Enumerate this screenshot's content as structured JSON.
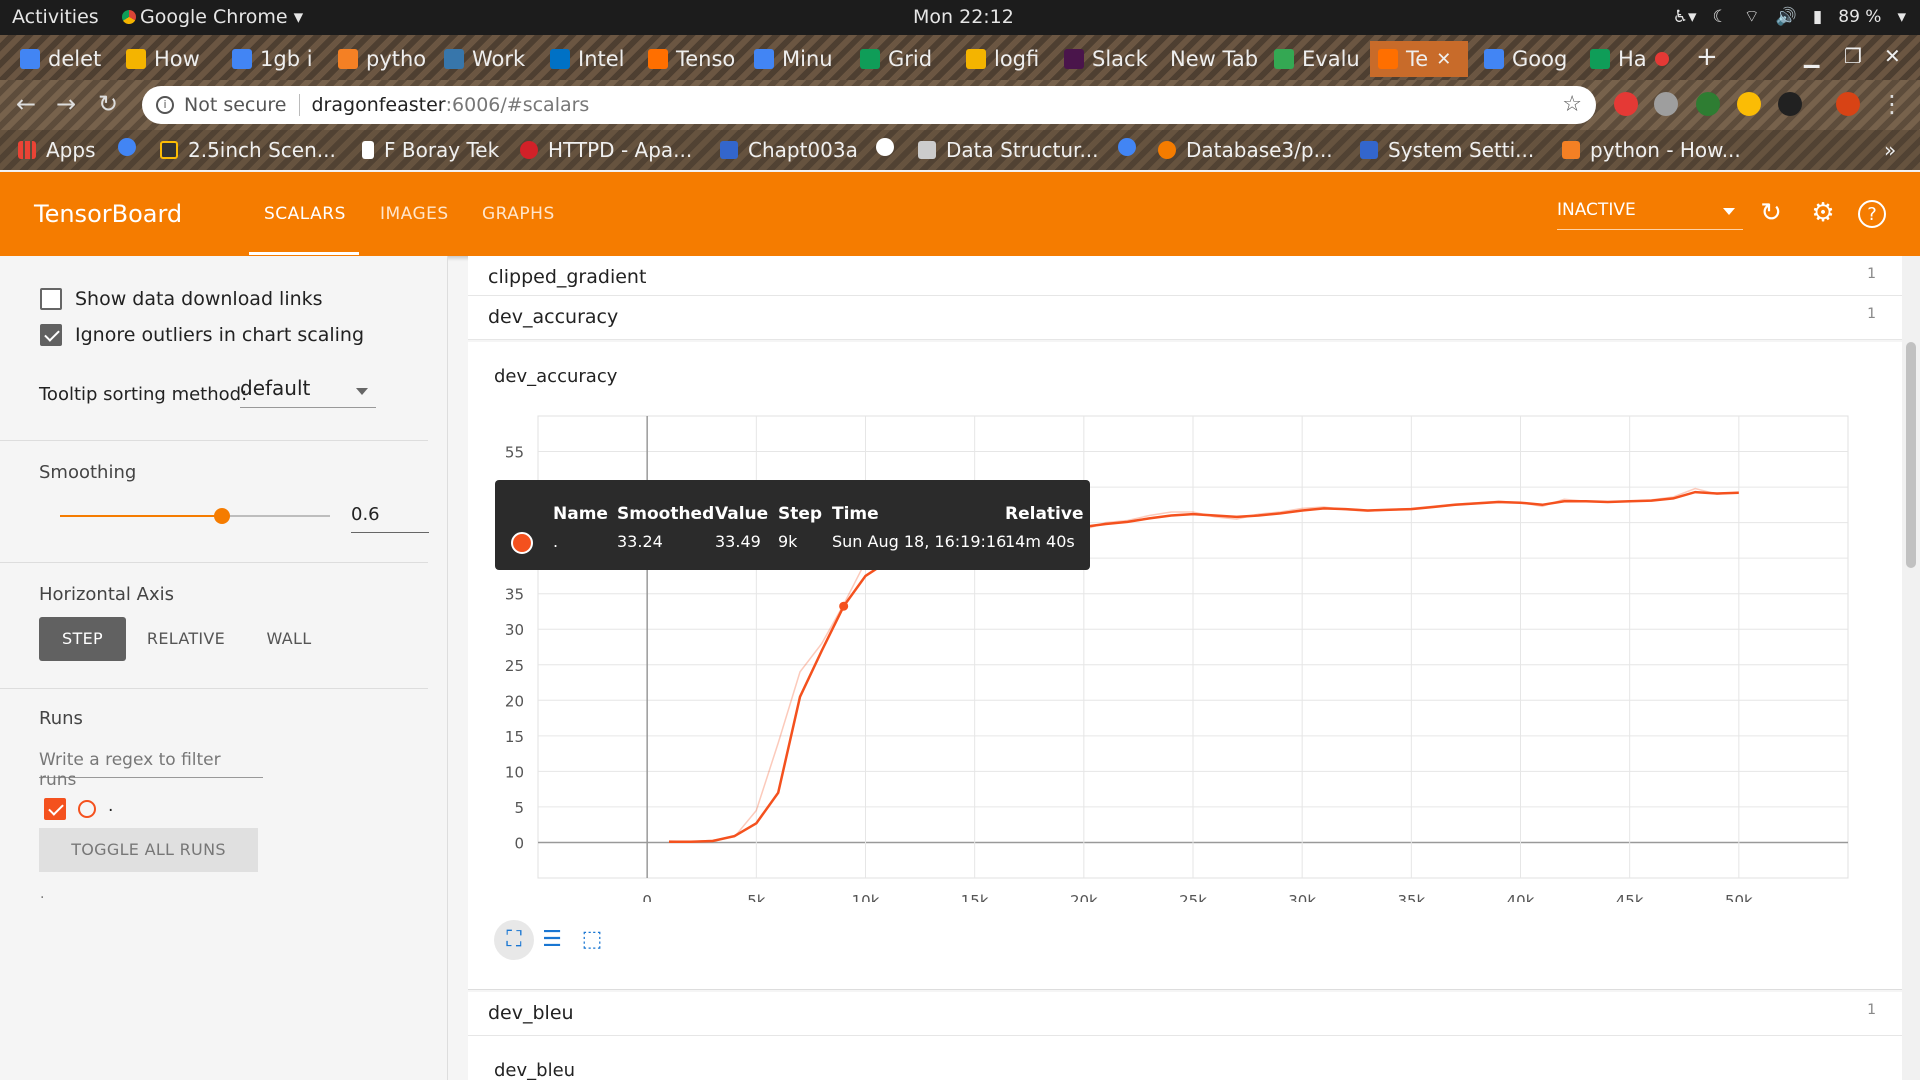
{
  "gnome": {
    "activities": "Activities",
    "app_name": "Google Chrome ▾",
    "clock": "Mon 22:12",
    "battery": "89 %"
  },
  "tabs": [
    {
      "title": "delet",
      "color": "#4285f4"
    },
    {
      "title": "How",
      "color": "#f4b400"
    },
    {
      "title": "1gb i",
      "color": "#4285f4"
    },
    {
      "title": "pytho",
      "color": "#f48024"
    },
    {
      "title": "Work",
      "color": "#3776ab"
    },
    {
      "title": "Intel",
      "color": "#0071c5"
    },
    {
      "title": "Tenso",
      "color": "#ff6f00"
    },
    {
      "title": "Minu",
      "color": "#4285f4"
    },
    {
      "title": "Grid",
      "color": "#0f9d58"
    },
    {
      "title": "logfi",
      "color": "#f4b400"
    },
    {
      "title": "Slack",
      "color": "#4a154b"
    },
    {
      "title": "New Tab",
      "color": ""
    },
    {
      "title": "Evalu",
      "color": "#34a853"
    },
    {
      "title": "Te",
      "color": "#ff6f00"
    },
    {
      "title": "Goog",
      "color": "#4285f4"
    },
    {
      "title": "Ha",
      "color": "#0f9d58"
    }
  ],
  "address": {
    "security": "Not secure",
    "host": "dragonfeaster",
    "path": ":6006/#scalars"
  },
  "bookmarks": [
    {
      "label": "Apps",
      "color": "#ea4335"
    },
    {
      "label": "2.5inch Scen...",
      "color": "#333333"
    },
    {
      "label": "F Boray Tek",
      "color": "#ffffff"
    },
    {
      "label": "HTTPD - Apa...",
      "color": "#d22128"
    },
    {
      "label": "Chapt003a",
      "color": "#3366cc"
    },
    {
      "label": "Data Structur...",
      "color": "#cccccc"
    },
    {
      "label": "Database3/p...",
      "color": "#f57c00"
    },
    {
      "label": "System Setti...",
      "color": "#3366cc"
    },
    {
      "label": "python - How...",
      "color": "#f48024"
    }
  ],
  "tensorboard": {
    "title": "TensorBoard",
    "tabs": [
      "SCALARS",
      "IMAGES",
      "GRAPHS"
    ],
    "run_state": "INACTIVE"
  },
  "sidebar": {
    "show_download": "Show data download links",
    "ignore_outliers": "Ignore outliers in chart scaling",
    "tooltip_sort_label": "Tooltip sorting method:",
    "tooltip_sort_value": "default",
    "smoothing_label": "Smoothing",
    "smoothing_value": "0.6",
    "smoothing_fraction": 0.6,
    "horizontal_axis_label": "Horizontal Axis",
    "axis_options": [
      "STEP",
      "RELATIVE",
      "WALL"
    ],
    "runs_label": "Runs",
    "regex_placeholder": "Write a regex to filter runs",
    "run_name": ".",
    "toggle_all": "TOGGLE ALL RUNS",
    "footer_dot": "."
  },
  "main": {
    "groups": [
      {
        "label": "clipped_gradient",
        "count": "1"
      },
      {
        "label": "dev_accuracy",
        "count": "1"
      },
      {
        "label": "dev_bleu",
        "count": "1"
      }
    ],
    "chart_title": "dev_accuracy",
    "next_chart_title": "dev_bleu"
  },
  "tooltip": {
    "headers": [
      "Name",
      "Smoothed",
      "Value",
      "Step",
      "Time",
      "Relative"
    ],
    "row": [
      ".",
      "33.24",
      "33.49",
      "9k",
      "Sun Aug 18, 16:19:16",
      "14m 40s"
    ]
  },
  "chart_data": {
    "type": "line",
    "title": "dev_accuracy",
    "xlim": [
      -5000,
      55000
    ],
    "ylim": [
      -5,
      60
    ],
    "x_ticks": [
      "0",
      "5k",
      "10k",
      "15k",
      "20k",
      "25k",
      "30k",
      "35k",
      "40k",
      "45k",
      "50k"
    ],
    "y_ticks": [
      "0",
      "5",
      "10",
      "15",
      "20",
      "25",
      "30",
      "35",
      "40",
      "45",
      "50",
      "55"
    ],
    "color": "#f4511e",
    "series": [
      {
        "role": "raw",
        "x": [
          1000,
          2000,
          3000,
          4000,
          5000,
          6000,
          7000,
          8000,
          9000,
          10000,
          11000,
          12000,
          13000,
          14000,
          15000,
          16000,
          17000,
          18000,
          19000,
          20000,
          21000,
          22000,
          23000,
          24000,
          25000,
          26000,
          27000,
          28000,
          29000,
          30000,
          31000,
          32000,
          33000,
          34000,
          35000,
          36000,
          37000,
          38000,
          39000,
          40000,
          41000,
          42000,
          43000,
          44000,
          45000,
          46000,
          47000,
          48000,
          49000,
          50000
        ],
        "y": [
          0.2,
          0.1,
          0.3,
          0.8,
          4.5,
          14.0,
          24.0,
          28.0,
          33.49,
          39.5,
          40.5,
          41.2,
          41.5,
          42.0,
          43.0,
          43.5,
          44.0,
          44.5,
          44.8,
          44.0,
          45.0,
          45.3,
          46.0,
          46.5,
          46.5,
          45.8,
          45.5,
          46.2,
          46.5,
          47.0,
          47.2,
          46.8,
          46.6,
          46.8,
          47.0,
          47.3,
          47.6,
          47.8,
          48.0,
          47.8,
          47.3,
          48.3,
          48.0,
          47.9,
          48.0,
          48.2,
          48.6,
          49.8,
          49.0,
          49.3
        ]
      },
      {
        "role": "smoothed",
        "x": [
          1000,
          2000,
          3000,
          4000,
          5000,
          6000,
          7000,
          8000,
          9000,
          10000,
          11000,
          12000,
          13000,
          14000,
          15000,
          16000,
          17000,
          18000,
          19000,
          20000,
          21000,
          22000,
          23000,
          24000,
          25000,
          26000,
          27000,
          28000,
          29000,
          30000,
          31000,
          32000,
          33000,
          34000,
          35000,
          36000,
          37000,
          38000,
          39000,
          40000,
          41000,
          42000,
          43000,
          44000,
          45000,
          46000,
          47000,
          48000,
          49000,
          50000
        ],
        "y": [
          0.1,
          0.1,
          0.2,
          0.9,
          2.7,
          7.0,
          20.5,
          27.0,
          33.24,
          37.5,
          39.5,
          40.8,
          41.3,
          41.8,
          42.6,
          43.2,
          43.7,
          44.2,
          44.6,
          44.4,
          44.8,
          45.1,
          45.6,
          46.0,
          46.2,
          46.0,
          45.8,
          46.0,
          46.3,
          46.7,
          47.0,
          46.9,
          46.7,
          46.8,
          46.9,
          47.2,
          47.5,
          47.7,
          47.9,
          47.8,
          47.5,
          48.0,
          48.0,
          47.9,
          48.0,
          48.1,
          48.4,
          49.3,
          49.1,
          49.2
        ]
      }
    ],
    "highlight": {
      "x": 9000,
      "y": 33.24
    },
    "grid": true
  }
}
